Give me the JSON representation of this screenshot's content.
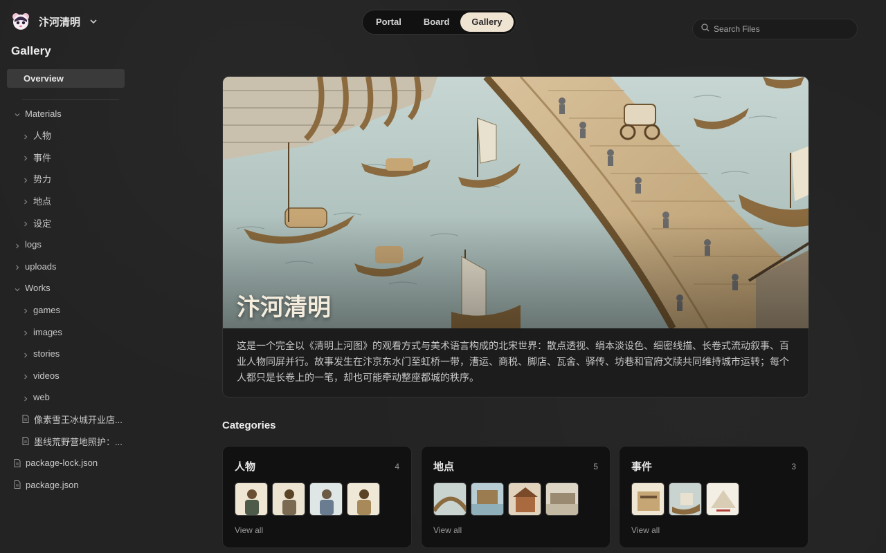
{
  "brand": {
    "name": "汴河清明"
  },
  "sidebar": {
    "title": "Gallery",
    "overview": "Overview",
    "tree": [
      {
        "label": "Materials",
        "level": 0,
        "kind": "folder",
        "open": true
      },
      {
        "label": "人物",
        "level": 1,
        "kind": "folder",
        "open": false
      },
      {
        "label": "事件",
        "level": 1,
        "kind": "folder",
        "open": false
      },
      {
        "label": "势力",
        "level": 1,
        "kind": "folder",
        "open": false
      },
      {
        "label": "地点",
        "level": 1,
        "kind": "folder",
        "open": false
      },
      {
        "label": "设定",
        "level": 1,
        "kind": "folder",
        "open": false
      },
      {
        "label": "logs",
        "level": 0,
        "kind": "folder",
        "open": false
      },
      {
        "label": "uploads",
        "level": 0,
        "kind": "folder",
        "open": false
      },
      {
        "label": "Works",
        "level": 0,
        "kind": "folder",
        "open": true
      },
      {
        "label": "games",
        "level": 1,
        "kind": "folder",
        "open": false
      },
      {
        "label": "images",
        "level": 1,
        "kind": "folder",
        "open": false
      },
      {
        "label": "stories",
        "level": 1,
        "kind": "folder",
        "open": false
      },
      {
        "label": "videos",
        "level": 1,
        "kind": "folder",
        "open": false
      },
      {
        "label": "web",
        "level": 1,
        "kind": "folder",
        "open": false
      },
      {
        "label": "像素雪王冰城开业店...",
        "level": 1,
        "kind": "file"
      },
      {
        "label": "墨线荒野营地照护：...",
        "level": 1,
        "kind": "file"
      },
      {
        "label": "package-lock.json",
        "level": 0,
        "kind": "file"
      },
      {
        "label": "package.json",
        "level": 0,
        "kind": "file"
      }
    ]
  },
  "topnav": {
    "tabs": [
      "Portal",
      "Board",
      "Gallery"
    ],
    "active": "Gallery"
  },
  "search": {
    "placeholder": "Search Files"
  },
  "hero": {
    "title": "汴河清明",
    "description": "这是一个完全以《清明上河图》的观看方式与美术语言构成的北宋世界：散点透视、绢本淡设色、细密线描、长卷式流动叙事、百业人物同屏并行。故事发生在汴京东水门至虹桥一带，漕运、商税、脚店、瓦舍、驿传、坊巷和官府文牍共同维持城市运转；每个人都只是长卷上的一笔，却也可能牵动整座都城的秩序。"
  },
  "categories": {
    "heading": "Categories",
    "view_all": "View all",
    "items": [
      {
        "name": "人物",
        "count": "4",
        "thumbs": 4
      },
      {
        "name": "地点",
        "count": "5",
        "thumbs": 4
      },
      {
        "name": "事件",
        "count": "3",
        "thumbs": 3
      }
    ]
  },
  "colors": {
    "accent_tab": "#efe3d2",
    "background": "#232323",
    "card": "#111111"
  }
}
